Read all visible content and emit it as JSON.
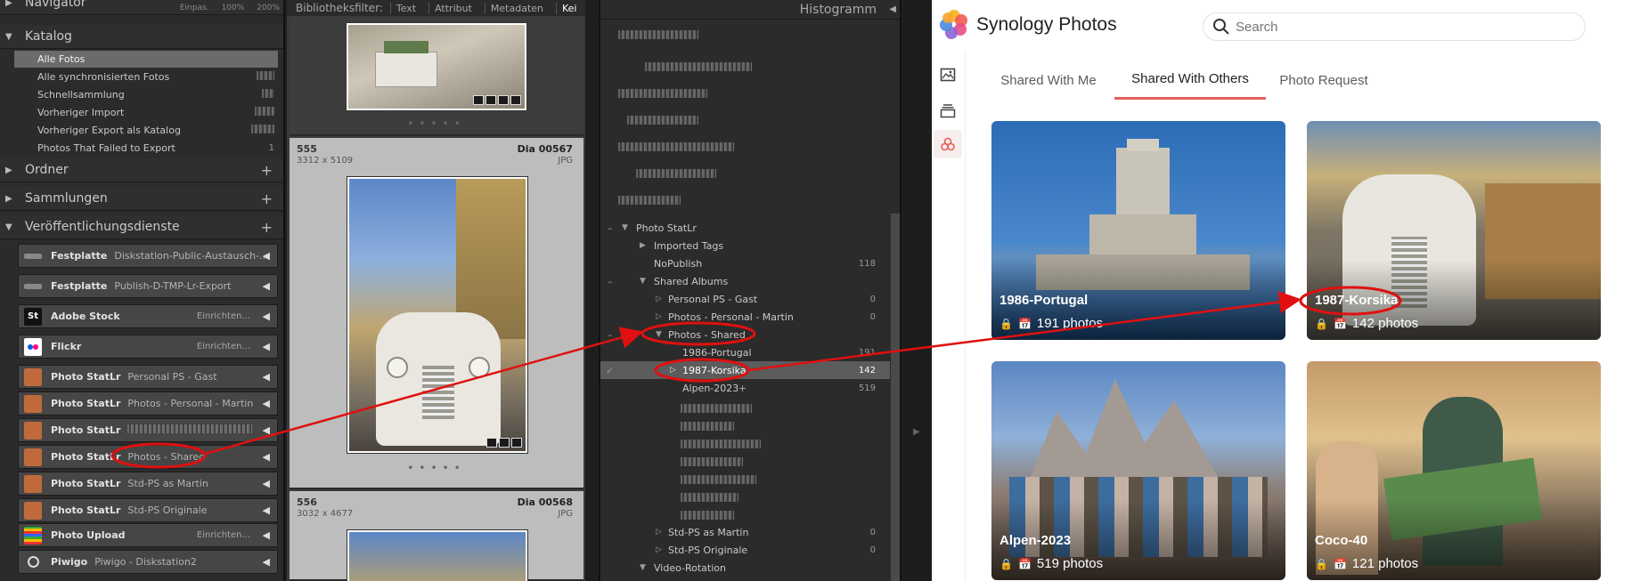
{
  "lightroom": {
    "navigator": {
      "title": "Navigator",
      "opts": [
        "Einpas.",
        "100%",
        "200%"
      ]
    },
    "catalog": {
      "title": "Katalog",
      "items": [
        {
          "label": "Alle Fotos",
          "count": ""
        },
        {
          "label": "Alle synchronisierten Fotos",
          "count": ""
        },
        {
          "label": "Schnellsammlung",
          "count": ""
        },
        {
          "label": "Vorheriger Import",
          "count": ""
        },
        {
          "label": "Vorheriger Export als Katalog",
          "count": ""
        },
        {
          "label": "Photos That Failed to Export",
          "count": "1"
        }
      ]
    },
    "sections": {
      "folders": "Ordner",
      "collections": "Sammlungen",
      "publish": "Veröffentlichungsdienste"
    },
    "publish_services": [
      {
        "name": "Festplatte",
        "target": "Diskstation-Public-Austausch-...",
        "action": ""
      },
      {
        "name": "Festplatte",
        "target": "Publish-D-TMP-Lr-Export",
        "action": ""
      },
      {
        "name": "Adobe Stock",
        "target": "",
        "action": "Einrichten..."
      },
      {
        "name": "Flickr",
        "target": "",
        "action": "Einrichten..."
      },
      {
        "name": "Photo StatLr",
        "target": "Personal PS - Gast",
        "action": ""
      },
      {
        "name": "Photo StatLr",
        "target": "Photos - Personal - Martin",
        "action": ""
      },
      {
        "name": "Photo StatLr",
        "target": "",
        "action": ""
      },
      {
        "name": "Photo StatLr",
        "target": "Photos - Shared",
        "action": ""
      },
      {
        "name": "Photo StatLr",
        "target": "Std-PS as Martin",
        "action": ""
      },
      {
        "name": "Photo StatLr",
        "target": "Std-PS Originale",
        "action": ""
      },
      {
        "name": "Photo Upload",
        "target": "",
        "action": "Einrichten..."
      },
      {
        "name": "Piwigo",
        "target": "Piwigo - Diskstation2",
        "action": ""
      }
    ],
    "filter": {
      "label": "Bibliotheksfilter:",
      "options": [
        "Text",
        "Attribut",
        "Metadaten",
        "Kei"
      ]
    },
    "grid": [
      {
        "index": "555",
        "dims": "3312 x 5109",
        "name": "Dia 00567",
        "ext": "JPG"
      },
      {
        "index": "556",
        "dims": "3032 x 4677",
        "name": "Dia 00568",
        "ext": "JPG"
      }
    ],
    "histogram": "Histogramm",
    "keywords": [
      {
        "label": "Photo StatLr",
        "count": ""
      },
      {
        "label": "Imported Tags",
        "count": ""
      },
      {
        "label": "NoPublish",
        "count": "118"
      },
      {
        "label": "Shared Albums",
        "count": ""
      },
      {
        "label": "Personal PS - Gast",
        "count": "0"
      },
      {
        "label": "Photos - Personal - Martin",
        "count": "0"
      },
      {
        "label": "Photos - Shared",
        "count": ""
      },
      {
        "label": "1986-Portugal",
        "count": "191"
      },
      {
        "label": "1987-Korsika",
        "count": "142"
      },
      {
        "label": "Alpen-2023",
        "count": "519"
      },
      {
        "label": "Std-PS as Martin",
        "count": "0"
      },
      {
        "label": "Std-PS Originale",
        "count": "0"
      },
      {
        "label": "Video-Rotation",
        "count": ""
      }
    ]
  },
  "synology": {
    "app_title": "Synology Photos",
    "search_placeholder": "Search",
    "tabs": [
      "Shared With Me",
      "Shared With Others",
      "Photo Request"
    ],
    "active_tab": "Shared With Others",
    "albums": [
      {
        "name": "1986-Portugal",
        "count": "191 photos"
      },
      {
        "name": "1987-Korsika",
        "count": "142 photos"
      },
      {
        "name": "Alpen-2023",
        "count": "519 photos"
      },
      {
        "name": "Coco-40",
        "count": "121 photos"
      }
    ],
    "accent": "#e5605a"
  },
  "annotations": {
    "color": "#e01010"
  }
}
